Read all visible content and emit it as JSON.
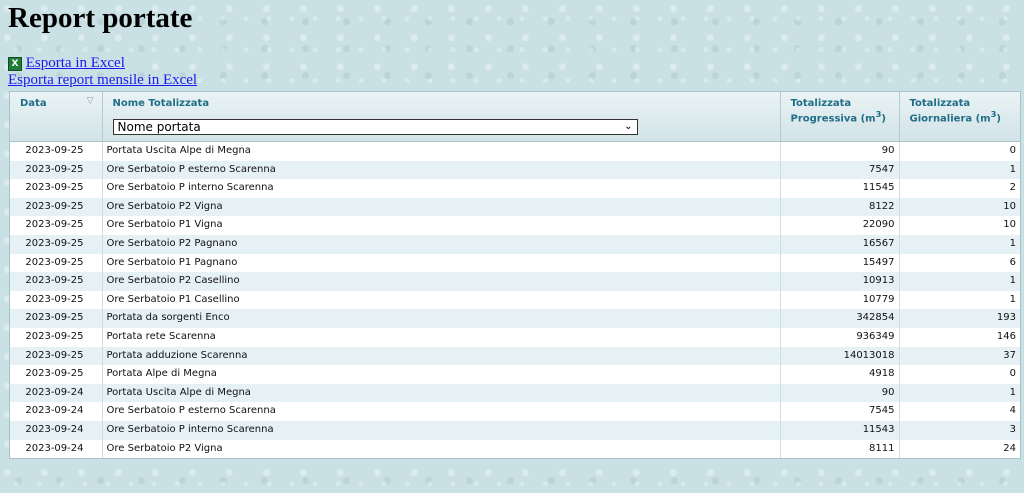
{
  "page": {
    "title": "Report portate"
  },
  "links": {
    "export_excel": "Esporta in Excel",
    "export_monthly": " Esporta report mensile in Excel"
  },
  "table": {
    "headers": {
      "date": "Data",
      "name": "Nome Totalizzata",
      "progressive_line1": "Totalizzata",
      "progressive_line2": "Progressiva (m",
      "daily_line1": "Totalizzata",
      "daily_line2": "Giornaliera (m",
      "unit_sup": "3",
      "unit_close": ")"
    },
    "filter": {
      "selected": "Nome portata"
    },
    "rows": [
      {
        "date": "2023-09-25",
        "name": "Portata Uscita Alpe di Megna",
        "progressive": "90",
        "daily": "0"
      },
      {
        "date": "2023-09-25",
        "name": "Ore Serbatoio P esterno Scarenna",
        "progressive": "7547",
        "daily": "1"
      },
      {
        "date": "2023-09-25",
        "name": "Ore Serbatoio P interno Scarenna",
        "progressive": "11545",
        "daily": "2"
      },
      {
        "date": "2023-09-25",
        "name": "Ore Serbatoio P2 Vigna",
        "progressive": "8122",
        "daily": "10"
      },
      {
        "date": "2023-09-25",
        "name": "Ore Serbatoio P1 Vigna",
        "progressive": "22090",
        "daily": "10"
      },
      {
        "date": "2023-09-25",
        "name": "Ore Serbatoio P2 Pagnano",
        "progressive": "16567",
        "daily": "1"
      },
      {
        "date": "2023-09-25",
        "name": "Ore Serbatoio P1 Pagnano",
        "progressive": "15497",
        "daily": "6"
      },
      {
        "date": "2023-09-25",
        "name": "Ore Serbatoio P2 Casellino",
        "progressive": "10913",
        "daily": "1"
      },
      {
        "date": "2023-09-25",
        "name": "Ore Serbatoio P1 Casellino",
        "progressive": "10779",
        "daily": "1"
      },
      {
        "date": "2023-09-25",
        "name": "Portata da sorgenti Enco",
        "progressive": "342854",
        "daily": "193"
      },
      {
        "date": "2023-09-25",
        "name": "Portata rete Scarenna",
        "progressive": "936349",
        "daily": "146"
      },
      {
        "date": "2023-09-25",
        "name": "Portata adduzione Scarenna",
        "progressive": "14013018",
        "daily": "37"
      },
      {
        "date": "2023-09-25",
        "name": "Portata Alpe di Megna",
        "progressive": "4918",
        "daily": "0"
      },
      {
        "date": "2023-09-24",
        "name": "Portata Uscita Alpe di Megna",
        "progressive": "90",
        "daily": "1"
      },
      {
        "date": "2023-09-24",
        "name": "Ore Serbatoio P esterno Scarenna",
        "progressive": "7545",
        "daily": "4"
      },
      {
        "date": "2023-09-24",
        "name": "Ore Serbatoio P interno Scarenna",
        "progressive": "11543",
        "daily": "3"
      },
      {
        "date": "2023-09-24",
        "name": "Ore Serbatoio P2 Vigna",
        "progressive": "8111",
        "daily": "24"
      }
    ]
  },
  "icons": {
    "excel": "excel-icon",
    "filter": "filter-icon",
    "dropdown": "chevron-down-icon"
  },
  "colors": {
    "header_text": "#1f6d86",
    "link": "#1a1aee",
    "alt_row": "#e6f1f5"
  }
}
